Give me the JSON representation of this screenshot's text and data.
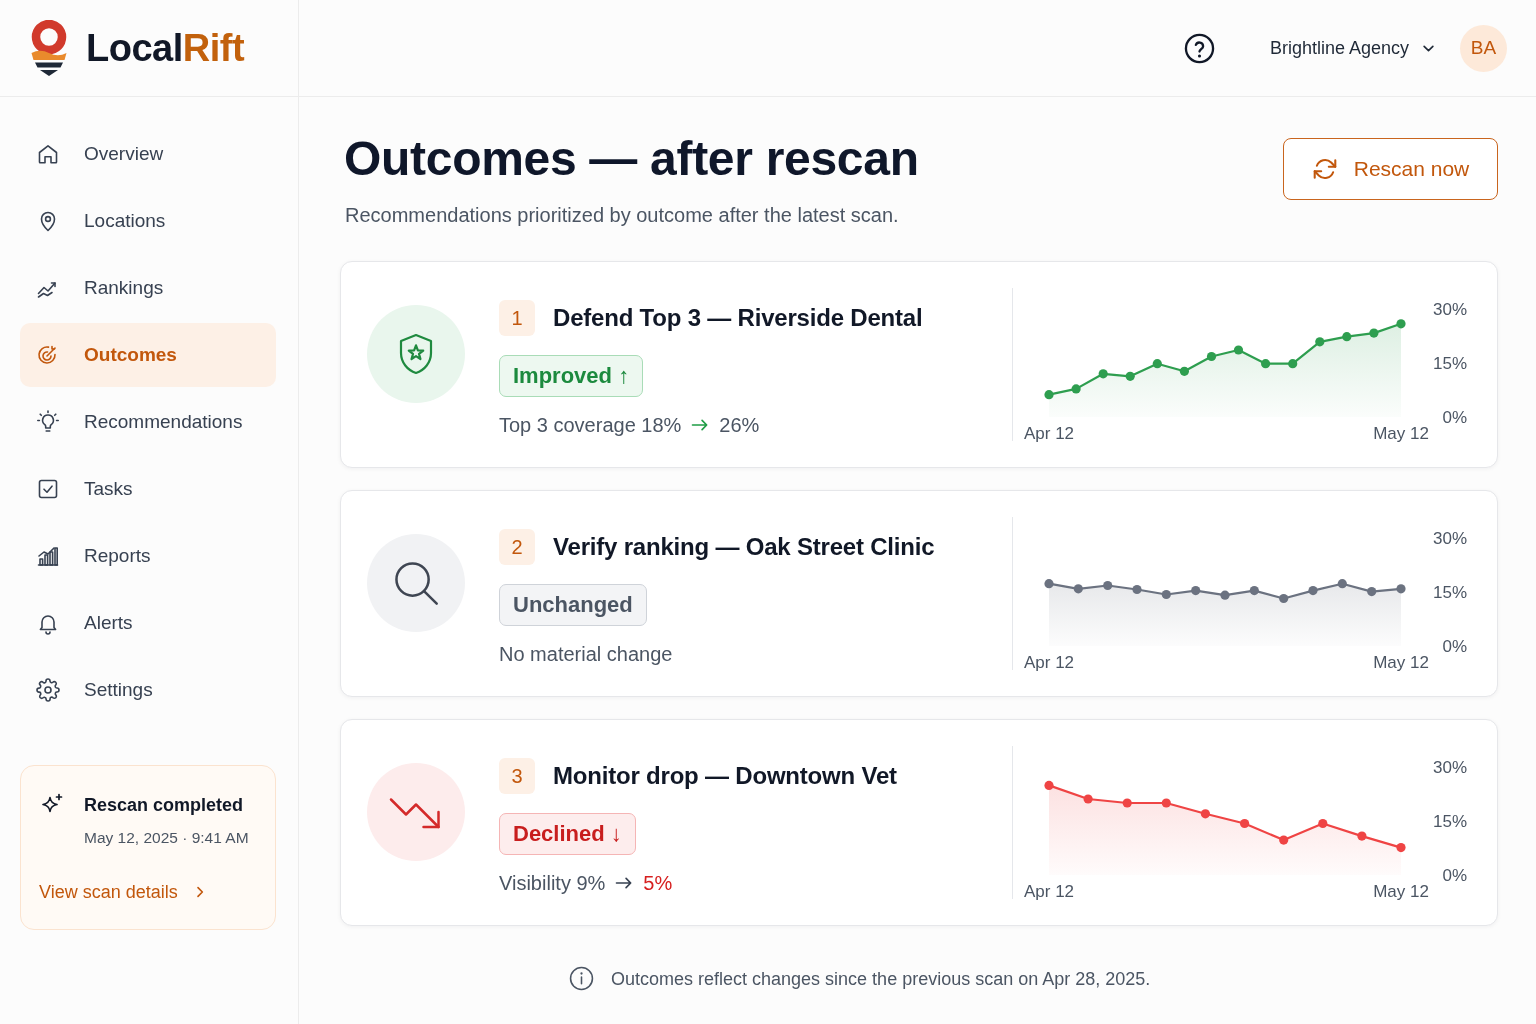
{
  "logo": {
    "text_parts": [
      "Local",
      "Rift"
    ]
  },
  "header": {
    "account": "Brightline Agency",
    "avatar": "BA"
  },
  "sidebar": {
    "items": [
      {
        "label": "Overview",
        "selected": false
      },
      {
        "label": "Locations",
        "selected": false
      },
      {
        "label": "Rankings",
        "selected": false
      },
      {
        "label": "Outcomes",
        "selected": true
      },
      {
        "label": "Recommendations",
        "selected": false
      },
      {
        "label": "Tasks",
        "selected": false
      },
      {
        "label": "Reports",
        "selected": false
      },
      {
        "label": "Alerts",
        "selected": false
      },
      {
        "label": "Settings",
        "selected": false
      }
    ],
    "scan_card": {
      "title": "Rescan completed",
      "timestamp": "May 12, 2025 · 9:41 AM",
      "link": "View scan details"
    }
  },
  "page": {
    "title": "Outcomes — after rescan",
    "subtitle": "Recommendations prioritized by outcome after the latest scan.",
    "action": "Rescan now"
  },
  "outcomes": [
    {
      "rank": "1",
      "title": "Defend Top 3 — Riverside Dental",
      "status": {
        "kind": "improved",
        "label": "Improved ↑"
      },
      "detail": {
        "text": "Top 3 coverage 18%",
        "to": "26%"
      },
      "chart_data": {
        "type": "area",
        "categories": [
          "Apr 12",
          null,
          null,
          null,
          null,
          null,
          null,
          null,
          null,
          null,
          null,
          null,
          null,
          "May 12"
        ],
        "series": [
          {
            "color": "#2e9e4f",
            "values": [
              6.2,
              7.8,
              12,
              11.3,
              14.8,
              12.7,
              16.8,
              18.6,
              14.8,
              14.8,
              20.9,
              22.3,
              23.3,
              25.9
            ]
          }
        ],
        "ylim": [
          0,
          30
        ],
        "yticks": [
          {
            "value": 0,
            "label": "0%"
          },
          {
            "value": 15,
            "label": "15%"
          },
          {
            "value": 30,
            "label": "30%"
          }
        ]
      }
    },
    {
      "rank": "2",
      "title": "Verify ranking — Oak Street Clinic",
      "status": {
        "kind": "unchanged",
        "label": "Unchanged"
      },
      "detail": {
        "text": "No material change"
      },
      "chart_data": {
        "type": "area",
        "categories": [
          "Apr 12",
          null,
          null,
          null,
          null,
          null,
          null,
          null,
          null,
          null,
          null,
          null,
          "May 12"
        ],
        "series": [
          {
            "color": "#6b7280",
            "values": [
              17.3,
              15.9,
              16.8,
              15.7,
              14.3,
              15.4,
              14.1,
              15.4,
              13.2,
              15.4,
              17.3,
              15.1,
              15.9
            ]
          }
        ],
        "ylim": [
          0,
          30
        ],
        "yticks": [
          {
            "value": 0,
            "label": "0%"
          },
          {
            "value": 15,
            "label": "15%"
          },
          {
            "value": 30,
            "label": "30%"
          }
        ]
      }
    },
    {
      "rank": "3",
      "title": "Monitor drop — Downtown Vet",
      "status": {
        "kind": "declined",
        "label": "Declined ↓"
      },
      "detail": {
        "text": "Visibility 9%",
        "to": "5%"
      },
      "chart_data": {
        "type": "area",
        "categories": [
          "Apr 12",
          null,
          null,
          null,
          null,
          null,
          null,
          null,
          null,
          "May 12"
        ],
        "series": [
          {
            "color": "#ef4444",
            "values": [
              24.9,
              21.1,
              20,
              20,
              17,
              14.3,
              9.7,
              14.3,
              10.8,
              7.6
            ]
          }
        ],
        "ylim": [
          0,
          30
        ],
        "yticks": [
          {
            "value": 0,
            "label": "0%"
          },
          {
            "value": 15,
            "label": "15%"
          },
          {
            "value": 30,
            "label": "30%"
          }
        ]
      }
    }
  ],
  "footnote": "Outcomes reflect changes since the previous scan on Apr 28, 2025."
}
